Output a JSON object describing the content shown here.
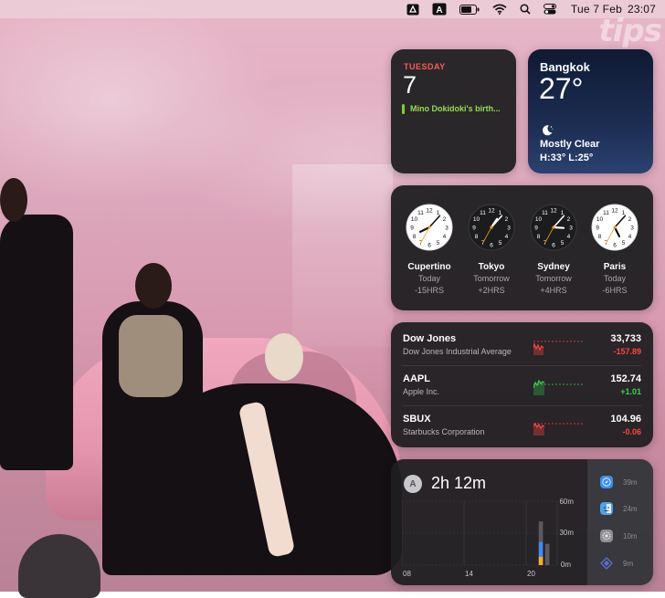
{
  "menubar": {
    "icons": [
      "drive-icon",
      "keyboard-input-icon",
      "battery-icon",
      "wifi-icon",
      "spotlight-search-icon",
      "control-center-icon"
    ],
    "input_letter": "A",
    "date": "Tue 7 Feb",
    "time": "23:07"
  },
  "watermark": "tips",
  "calendar": {
    "day": "TUESDAY",
    "date": "7",
    "event": "Mino Dokidoki's birth...",
    "accent": "#ff5a4f",
    "event_color": "#7ed321"
  },
  "weather": {
    "city": "Bangkok",
    "temp": "27°",
    "condition": "Mostly Clear",
    "high_low": "H:33° L:25°",
    "icon": "moon-icon"
  },
  "world_clock": [
    {
      "city": "Cupertino",
      "day": "Today",
      "offset": "-15HRS",
      "face": "light",
      "hour": 8,
      "minute": 7
    },
    {
      "city": "Tokyo",
      "day": "Tomorrow",
      "offset": "+2HRS",
      "face": "dark",
      "hour": 1,
      "minute": 7
    },
    {
      "city": "Sydney",
      "day": "Tomorrow",
      "offset": "+4HRS",
      "face": "dark",
      "hour": 3,
      "minute": 7
    },
    {
      "city": "Paris",
      "day": "Today",
      "offset": "-6HRS",
      "face": "light",
      "hour": 17,
      "minute": 7
    }
  ],
  "stocks": [
    {
      "symbol": "Dow Jones",
      "name": "Dow Jones Industrial Average",
      "price": "33,733",
      "change": "-157.89",
      "color": "#ff453a"
    },
    {
      "symbol": "AAPL",
      "name": "Apple Inc.",
      "price": "152.74",
      "change": "+1.01",
      "color": "#32d74b"
    },
    {
      "symbol": "SBUX",
      "name": "Starbucks Corporation",
      "price": "104.96",
      "change": "-0.06",
      "color": "#ff453a"
    }
  ],
  "screen_time": {
    "avatar": "A",
    "total": "2h 12m",
    "y_labels": [
      "60m",
      "30m",
      "0m"
    ],
    "x_labels": [
      "08",
      "14",
      "20"
    ],
    "bars": [
      {
        "hour_index": 21,
        "total_min": 41,
        "segments": [
          {
            "min": 8,
            "color": "#ffb020"
          },
          {
            "min": 14,
            "color": "#3d8bff"
          },
          {
            "min": 19,
            "color": "#5a5a5e"
          }
        ]
      },
      {
        "hour_index": 22,
        "total_min": 20,
        "segments": [
          {
            "min": 20,
            "color": "#5a5a5e"
          }
        ]
      }
    ],
    "apps": [
      {
        "icon": "safari-icon",
        "time": "39m",
        "color": "#3a8ef6"
      },
      {
        "icon": "finder-icon",
        "time": "24m",
        "color": "#4aa3f0"
      },
      {
        "icon": "system-settings-icon",
        "time": "10m",
        "color": "#8e8e93"
      },
      {
        "icon": "network-app-icon",
        "time": "9m",
        "color": "#5a6fd8"
      }
    ]
  }
}
